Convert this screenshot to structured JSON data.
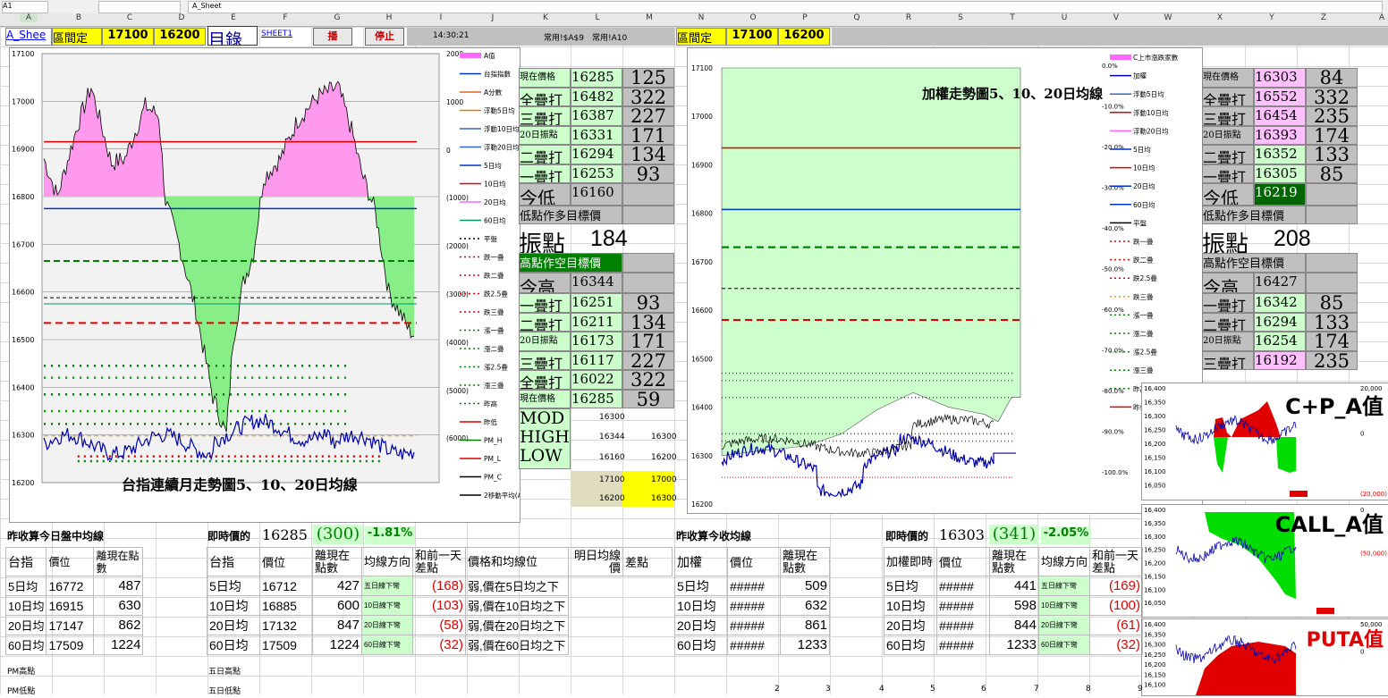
{
  "topbar": {
    "cell_ref": "A1",
    "sheet_formula": "A_Sheet"
  },
  "columns": [
    "A",
    "B",
    "C",
    "D",
    "E",
    "F",
    "G",
    "H",
    "I",
    "J",
    "K",
    "L",
    "M",
    "N",
    "O",
    "P",
    "Q",
    "R",
    "S",
    "T",
    "U",
    "V",
    "W",
    "X",
    "Y",
    "Z",
    "A"
  ],
  "row1": {
    "sheet_link": "A_Shee",
    "range_label": "區間定",
    "low": "17100",
    "high": "16200",
    "index_link": "目錄",
    "sheet1_link": "SHEET1",
    "play_btn": "播",
    "stop_btn": "停止",
    "time": "14:30:21",
    "note1": "常用!$A$9",
    "note2": "常用!A10",
    "range_label2": "區間定",
    "low2": "17100",
    "high2": "16200"
  },
  "left_chart": {
    "title": "台指連續月走勢圖5、10、20日均線",
    "yticks": [
      "17100",
      "17000",
      "16900",
      "16800",
      "16700",
      "16600",
      "16500",
      "16400",
      "16300",
      "16200"
    ],
    "right_ticks": [
      "2000",
      "1000",
      "0",
      "(1000)",
      "(2000)",
      "(3000)",
      "(4000)",
      "(5000)",
      "(6000)"
    ],
    "legend": [
      "A值",
      "台指指數",
      "A分數",
      "浮動5日均",
      "浮動10日均",
      "浮動20日均",
      "5日均",
      "10日均",
      "20日均",
      "60日均",
      "平盤",
      "跌一疊",
      "跌二疊",
      "跌2.5疊",
      "跌三疊",
      "漲一疊",
      "漲二疊",
      "漲2.5疊",
      "漲三疊",
      "昨高",
      "昨低",
      "PM_H",
      "PM_L",
      "PM_C",
      "2移動平均(A值)"
    ]
  },
  "panel1": {
    "rows": [
      {
        "label": "現在價格",
        "val": "16285",
        "diff": "125",
        "cls": "lgreen"
      },
      {
        "label": "全疊打",
        "val": "16482",
        "diff": "322",
        "cls": "lgreen"
      },
      {
        "label": "三疊打",
        "val": "16387",
        "diff": "227",
        "cls": "lgreen"
      },
      {
        "label": "20日振點",
        "val": "16331",
        "diff": "171",
        "cls": "lgreen"
      },
      {
        "label": "二疊打",
        "val": "16294",
        "diff": "134",
        "cls": "lgreen"
      },
      {
        "label": "一疊打",
        "val": "16253",
        "diff": "93",
        "cls": "lgreen"
      }
    ],
    "low_label": "今低",
    "low_val": "16160",
    "low_target": "低點作多目標價",
    "pivot_label": "振點",
    "pivot_val": "184",
    "high_target": "高點作空目標價",
    "high_label": "今高",
    "high_val": "16344",
    "rows2": [
      {
        "label": "一疊打",
        "val": "16251",
        "diff": "93"
      },
      {
        "label": "二疊打",
        "val": "16211",
        "diff": "134"
      },
      {
        "label": "20日振點",
        "val": "16173",
        "diff": "171"
      },
      {
        "label": "三疊打",
        "val": "16117",
        "diff": "227"
      },
      {
        "label": "全疊打",
        "val": "16022",
        "diff": "322"
      },
      {
        "label": "現在價格",
        "val": "16285",
        "diff": "59"
      }
    ],
    "mod": "MOD",
    "high": "HIGH",
    "low": "LOW",
    "mod_vals": [
      "16300",
      "16344",
      "16300",
      "16160",
      "16200"
    ],
    "yel_vals": [
      "17100",
      "17000",
      "16200",
      "16300"
    ]
  },
  "right_chart": {
    "title": "加權走勢圖5、10、20日均線",
    "yticks": [
      "17100",
      "17000",
      "16900",
      "16800",
      "16700",
      "16600",
      "16500",
      "16400",
      "16300",
      "16200"
    ],
    "pct_ticks": [
      "0.0%",
      "-10.0%",
      "-20.0%",
      "-30.0%",
      "-40.0%",
      "-50.0%",
      "-60.0%",
      "-70.0%",
      "-80.0%",
      "-90.0%",
      "-100.0%"
    ],
    "legend": [
      "C上市漲跌家數",
      "加權",
      "浮動5日均",
      "浮動10日均",
      "浮動20日均",
      "5日均",
      "10日均",
      "20日均",
      "60日均",
      "平盤",
      "跌一疊",
      "跌二疊",
      "跌2.5疊",
      "跌三疊",
      "漲一疊",
      "漲二疊",
      "漲2.5疊",
      "漲三疊",
      "昨高",
      "昨低"
    ]
  },
  "panel2": {
    "rows": [
      {
        "label": "現在價格",
        "val": "16303",
        "diff": "84"
      },
      {
        "label": "全疊打",
        "val": "16552",
        "diff": "332"
      },
      {
        "label": "三疊打",
        "val": "16454",
        "diff": "235"
      },
      {
        "label": "20日振點",
        "val": "16393",
        "diff": "174"
      },
      {
        "label": "二疊打",
        "val": "16352",
        "diff": "133"
      },
      {
        "label": "一疊打",
        "val": "16305",
        "diff": "85"
      }
    ],
    "low_label": "今低",
    "low_val": "16219",
    "low_target": "低點作多目標價",
    "pivot_label": "振點",
    "pivot_val": "208",
    "high_target": "高點作空目標價",
    "high_label": "今高",
    "high_val": "16427",
    "rows2": [
      {
        "label": "一疊打",
        "val": "16342",
        "diff": "85"
      },
      {
        "label": "二疊打",
        "val": "16294",
        "diff": "133"
      },
      {
        "label": "20日振點",
        "val": "16254",
        "diff": "174"
      },
      {
        "label": "三疊打",
        "val": "16192",
        "diff": "235"
      }
    ]
  },
  "mini_charts": [
    {
      "title": "C+P_A值",
      "yticks": [
        "16,400",
        "16,350",
        "16,300",
        "16,250",
        "16,200",
        "16,150",
        "16,100",
        "16,050"
      ],
      "rticks": [
        "20,000",
        "0",
        "(20,000)"
      ]
    },
    {
      "title": "CALL_A值",
      "yticks": [
        "16,400",
        "16,350",
        "16,300",
        "16,250",
        "16,200",
        "16,150",
        "16,100",
        "16,050"
      ],
      "rticks": [
        "0",
        "(50,000)"
      ]
    },
    {
      "title": "PUTA值",
      "yticks": [
        "16,400",
        "16,350",
        "16,300",
        "16,250",
        "16,200",
        "16,150",
        "16,100"
      ],
      "rticks": [
        "50,000",
        "0"
      ]
    }
  ],
  "bottom_left": {
    "title": "昨收算今日盤中均線",
    "headers": [
      "台指",
      "價位",
      "離現在點數"
    ],
    "rows": [
      [
        "5日均",
        "16772",
        "487"
      ],
      [
        "10日均",
        "16915",
        "630"
      ],
      [
        "20日均",
        "17147",
        "862"
      ],
      [
        "60日均",
        "17509",
        "1224"
      ]
    ],
    "pm_high": "PM高點",
    "pm_low": "PM低點"
  },
  "bottom_mid": {
    "now_label": "即時價的",
    "now_val": "16285",
    "chg": "(300)",
    "pct": "-1.81%",
    "headers": [
      "台指",
      "價位",
      "離現在點數",
      "均線方向",
      "和前一天差點",
      "價格和均線位",
      "明日均線價",
      "差點"
    ],
    "rows": [
      [
        "5日均",
        "16712",
        "427",
        "五日線下彎",
        "(168)",
        "弱,價在5日均之下"
      ],
      [
        "10日均",
        "16885",
        "600",
        "10日線下彎",
        "(103)",
        "弱,價在10日均之下"
      ],
      [
        "20日均",
        "17132",
        "847",
        "20日線下彎",
        "(58)",
        "弱,價在20日均之下"
      ],
      [
        "60日均",
        "17509",
        "1224",
        "60日線下彎",
        "(32)",
        "弱,價在60日均之下"
      ]
    ],
    "five_high": "五日高點",
    "five_low": "五日低點"
  },
  "bottom_right1": {
    "title": "昨收算今收均線",
    "headers": [
      "加權",
      "價位",
      "離現在點數"
    ],
    "rows": [
      [
        "5日均",
        "#####",
        "509"
      ],
      [
        "10日均",
        "#####",
        "632"
      ],
      [
        "20日均",
        "#####",
        "861"
      ],
      [
        "60日均",
        "#####",
        "1233"
      ]
    ]
  },
  "bottom_right2": {
    "now_label": "加權即時",
    "now_head": "即時價的",
    "now_val": "16303",
    "chg": "(341)",
    "pct": "-2.05%",
    "headers": [
      "加權即時",
      "價位",
      "離現在點數",
      "均線方向",
      "和前一天差點"
    ],
    "rows": [
      [
        "5日均",
        "#####",
        "441",
        "五日線下彎",
        "(169)"
      ],
      [
        "10日均",
        "#####",
        "598",
        "10日線下彎",
        "(100)"
      ],
      [
        "20日均",
        "#####",
        "844",
        "20日線下彎",
        "(61)"
      ],
      [
        "60日均",
        "#####",
        "1233",
        "60日線下彎",
        "(32)"
      ]
    ],
    "footer_nums": [
      "2",
      "3",
      "4",
      "5",
      "6",
      "7",
      "8",
      "9"
    ]
  }
}
